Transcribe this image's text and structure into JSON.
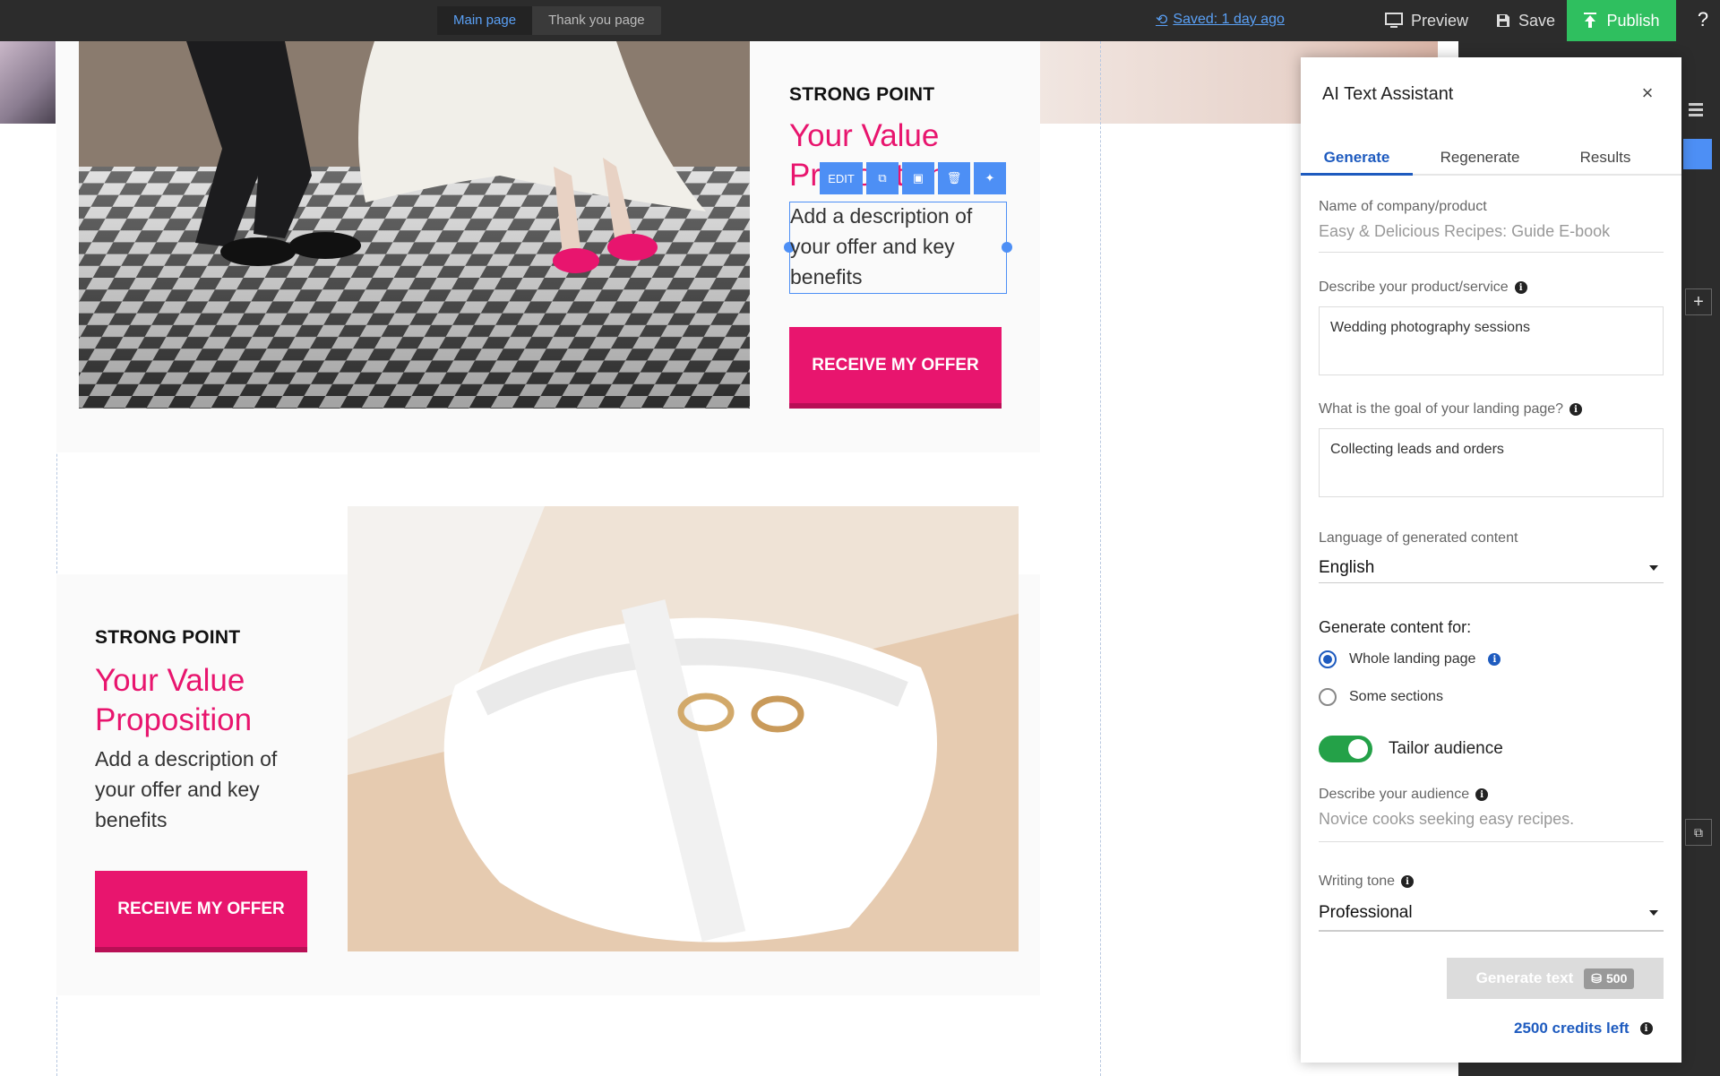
{
  "topbar": {
    "page_tabs": [
      "Main page",
      "Thank you page"
    ],
    "saved_label": "Saved: 1 day ago",
    "preview_label": "Preview",
    "save_label": "Save",
    "publish_label": "Publish",
    "help_label": "?"
  },
  "section1": {
    "kicker": "STRONG POINT",
    "title": "Your Value Proposition",
    "description": "Add a description of your offer and key benefits",
    "cta": "RECEIVE MY OFFER",
    "toolbar_edit": "EDIT"
  },
  "section2": {
    "kicker": "STRONG POINT",
    "title_line1": "Your Value",
    "title_line2": "Proposition",
    "description": "Add a description of your offer and key benefits",
    "cta": "RECEIVE MY OFFER"
  },
  "panel": {
    "title": "AI Text Assistant",
    "close": "×",
    "tabs": [
      "Generate",
      "Regenerate",
      "Results"
    ],
    "company_label": "Name of company/product",
    "company_placeholder": "Easy & Delicious Recipes: Guide E-book",
    "product_label": "Describe your product/service",
    "product_value": "Wedding photography sessions",
    "goal_label": "What is the goal of your landing page?",
    "goal_value": "Collecting leads and orders",
    "language_label": "Language of generated content",
    "language_value": "English",
    "generate_for_label": "Generate content for:",
    "option_whole": "Whole landing page",
    "option_some": "Some sections",
    "tailor_label": "Tailor audience",
    "audience_label": "Describe your audience",
    "audience_placeholder": "Novice cooks seeking easy recipes.",
    "tone_label": "Writing tone",
    "tone_value": "Professional",
    "generate_button": "Generate text",
    "generate_cost": "500",
    "credits_left": "2500 credits left"
  },
  "colors": {
    "accent_pink": "#e8156e",
    "publish_green": "#2fbf5f",
    "panel_blue": "#1e5bbf",
    "toggle_green": "#24a148"
  }
}
